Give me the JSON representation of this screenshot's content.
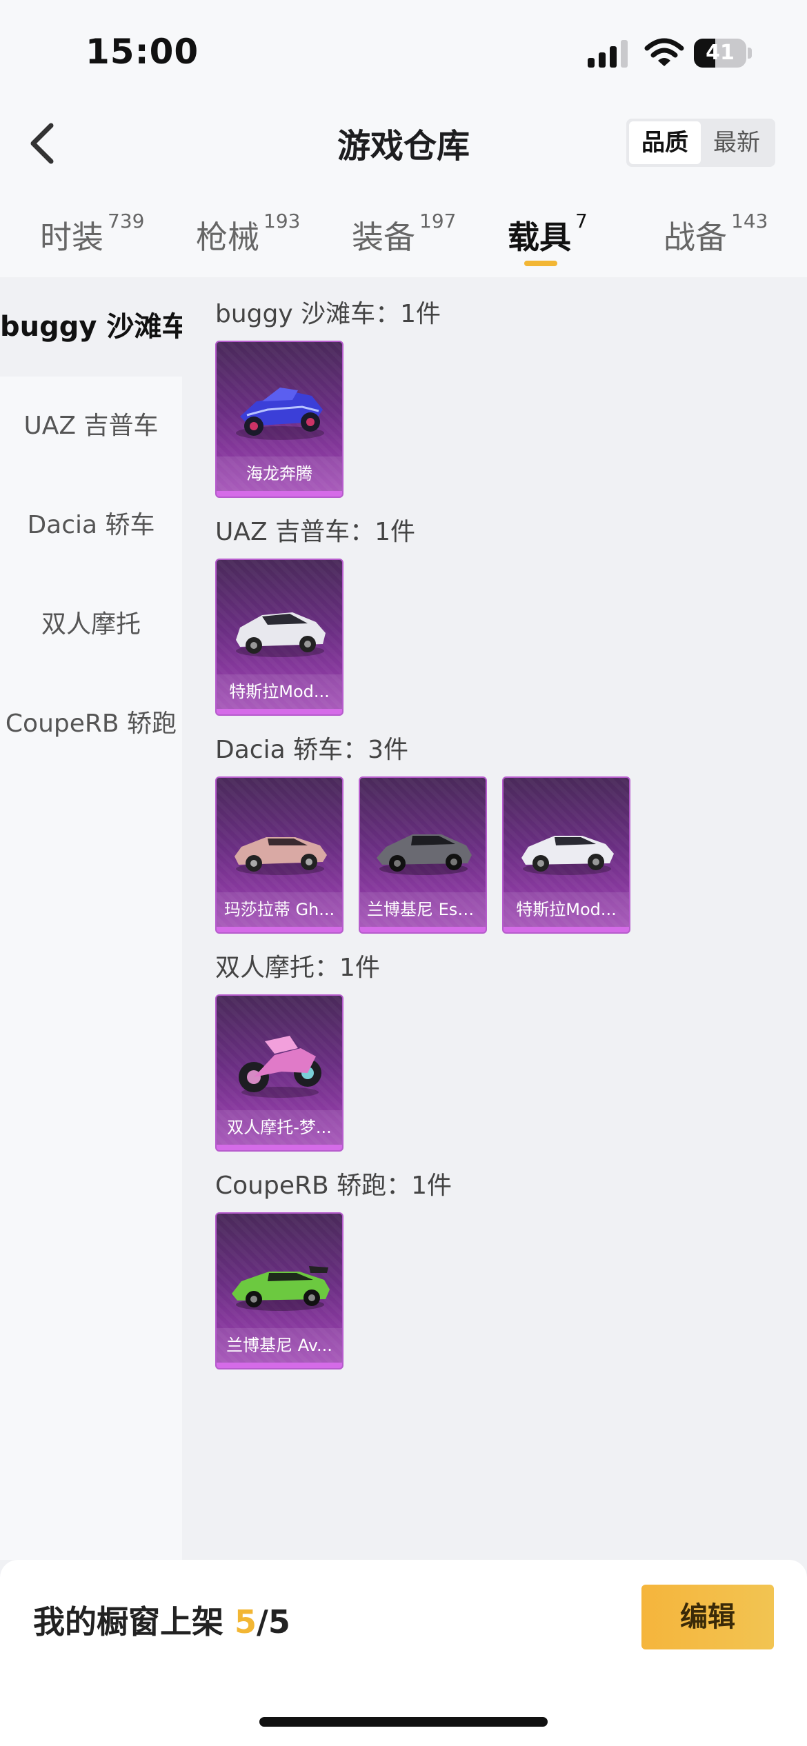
{
  "status_bar": {
    "time": "15:00",
    "battery_level": "41",
    "battery_fraction": 0.41
  },
  "header": {
    "title": "游戏仓库",
    "sort_quality": "品质",
    "sort_newest": "最新"
  },
  "tabs": [
    {
      "label": "时装",
      "count": "739"
    },
    {
      "label": "枪械",
      "count": "193"
    },
    {
      "label": "装备",
      "count": "197"
    },
    {
      "label": "载具",
      "count": "7"
    },
    {
      "label": "战备",
      "count": "143"
    }
  ],
  "active_tab": "载具",
  "sidebar": {
    "items": [
      {
        "label": "buggy 沙滩车"
      },
      {
        "label": "UAZ 吉普车"
      },
      {
        "label": "Dacia 轿车"
      },
      {
        "label": "双人摩托"
      },
      {
        "label": "CoupeRB 轿跑"
      }
    ]
  },
  "sections": [
    {
      "title": "buggy 沙滩车：1件",
      "items": [
        {
          "name": "海龙奔腾",
          "icon": "buggy-blue-icon"
        }
      ]
    },
    {
      "title": "UAZ 吉普车：1件",
      "items": [
        {
          "name": "特斯拉Mod...",
          "icon": "tesla-x-white-icon"
        }
      ]
    },
    {
      "title": "Dacia 轿车：3件",
      "items": [
        {
          "name": "玛莎拉蒂 Gh...",
          "icon": "maserati-pink-icon"
        },
        {
          "name": "兰博基尼 Est...",
          "icon": "lamborghini-grey-icon"
        },
        {
          "name": "特斯拉Mod...",
          "icon": "tesla-3-white-icon"
        }
      ]
    },
    {
      "title": "双人摩托：1件",
      "items": [
        {
          "name": "双人摩托-梦...",
          "icon": "motorbike-pink-icon"
        }
      ]
    },
    {
      "title": "CoupeRB 轿跑：1件",
      "items": [
        {
          "name": "兰博基尼 Av...",
          "icon": "lamborghini-green-icon"
        }
      ]
    }
  ],
  "bottom": {
    "showcase_label": "我的橱窗上架",
    "current": "5",
    "total": "/5",
    "edit_label": "编辑"
  },
  "colors": {
    "accent": "#f2b634",
    "card_purple": "#8a3aa0",
    "card_border": "#b65ccc"
  }
}
